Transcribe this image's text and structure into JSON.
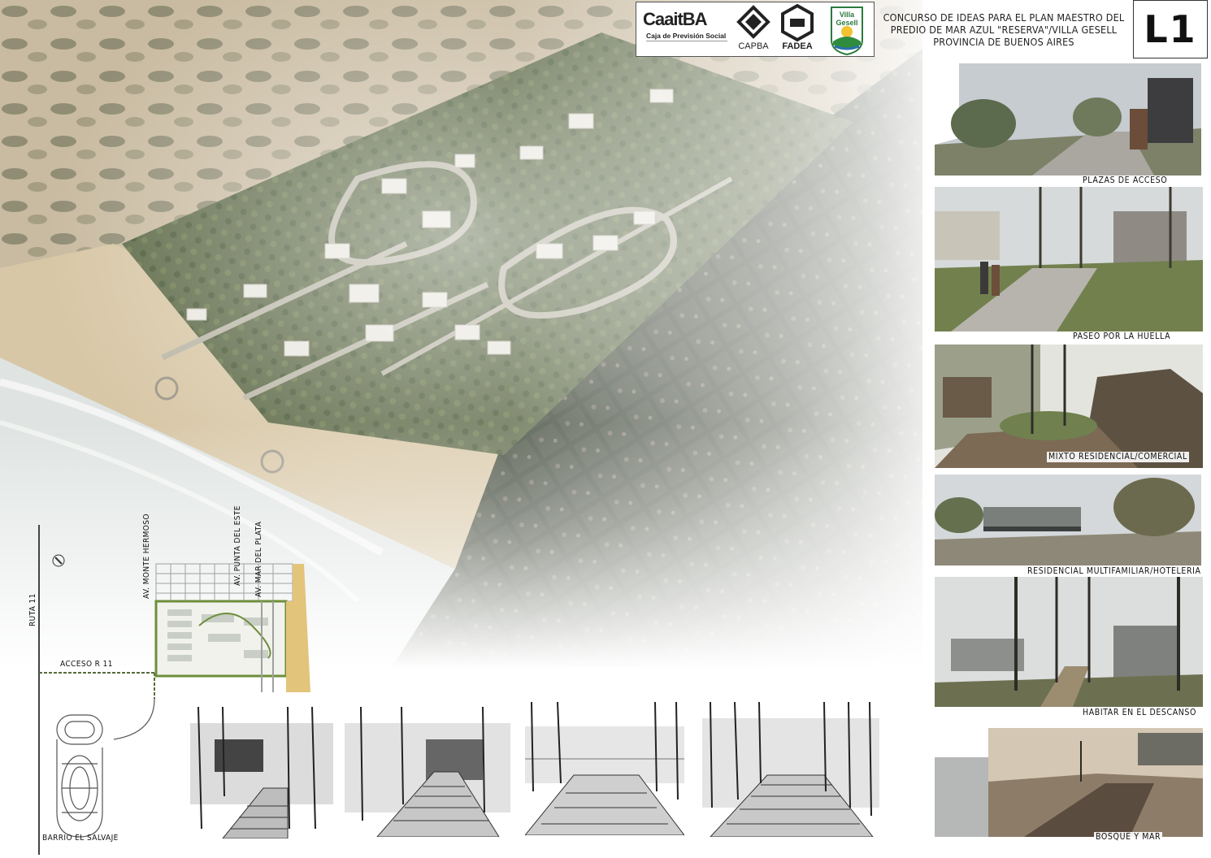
{
  "header": {
    "logos": {
      "caaitba_name": "CaaitBA",
      "caaitba_subtitle": "Caja de Previsión Social",
      "capba": "CAPBA",
      "fadea": "FADEA",
      "villa_gesell": "Villa Gesell"
    },
    "title_lines": [
      "CONCURSO DE IDEAS PARA EL PLAN MAESTRO DEL",
      "PREDIO DE MAR AZUL \"RESERVA\"/VILLA GESELL",
      "PROVINCIA DE BUENOS AIRES"
    ],
    "sheet_id": "L1"
  },
  "renders": [
    {
      "caption": "PLAZAS DE ACCESO"
    },
    {
      "caption": "PASEO POR LA HUELLA"
    },
    {
      "caption": "MIXTO RESIDENCIAL/COMERCIAL"
    },
    {
      "caption": "RESIDENCIAL MULTIFAMILIAR/HOTELERIA"
    },
    {
      "caption": "HABITAR EN EL DESCANSO"
    },
    {
      "caption": "BOSQUE Y MAR"
    }
  ],
  "location_plan": {
    "road": "RUTA 11",
    "access": "ACCESO R 11",
    "avenues": [
      "AV. MONTE HERMOSO",
      "AV. PUNTA DEL ESTE",
      "AV. MAR DEL PLATA"
    ],
    "neighborhood": "BARRIO EL SALVAJE"
  },
  "colors": {
    "sand": "#cdbfa6",
    "forest": "#3f4a35",
    "sea": "#dfe4e2",
    "beach_strip": "#e2c47a"
  }
}
